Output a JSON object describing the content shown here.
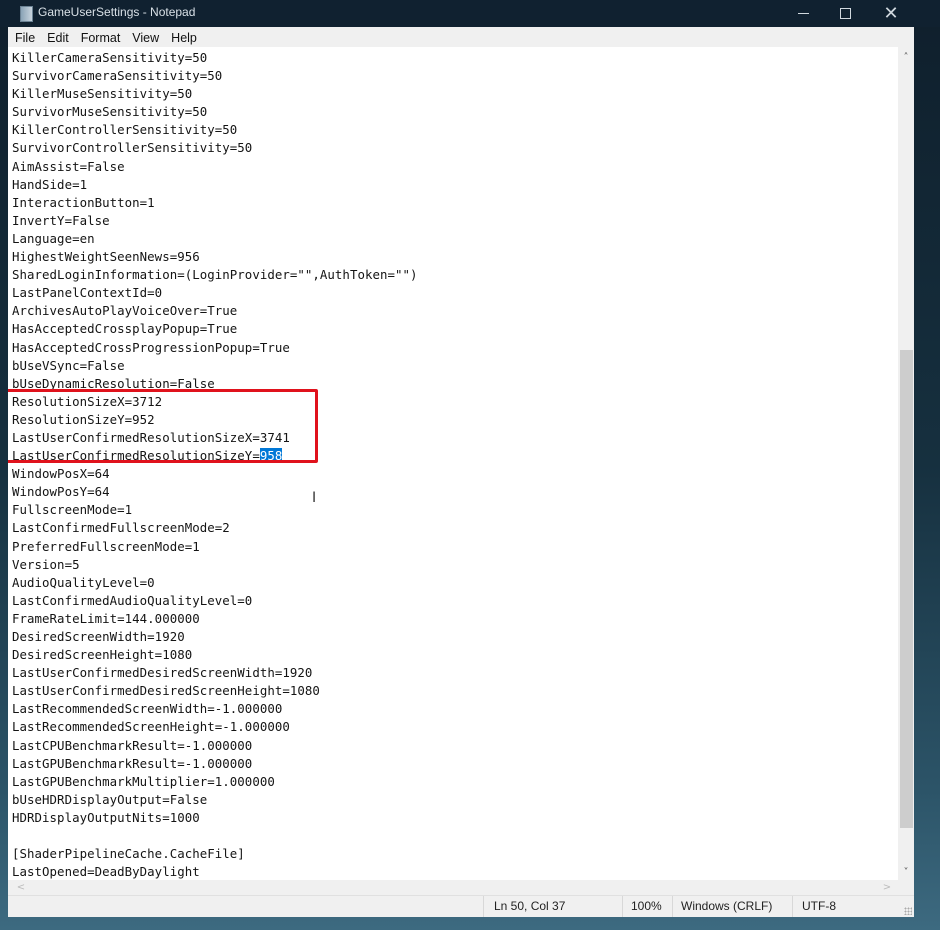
{
  "window": {
    "title": "GameUserSettings - Notepad",
    "app_icon": "notepad-icon",
    "controls": {
      "minimize": "minimize-icon",
      "maximize": "maximize-icon",
      "close": "close-icon",
      "close_glyph": "✕"
    }
  },
  "menu": {
    "items": [
      "File",
      "Edit",
      "Format",
      "View",
      "Help"
    ]
  },
  "editor": {
    "lines": [
      "KillerCameraSensitivity=50",
      "SurvivorCameraSensitivity=50",
      "KillerMuseSensitivity=50",
      "SurvivorMuseSensitivity=50",
      "KillerControllerSensitivity=50",
      "SurvivorControllerSensitivity=50",
      "AimAssist=False",
      "HandSide=1",
      "InteractionButton=1",
      "InvertY=False",
      "Language=en",
      "HighestWeightSeenNews=956",
      "SharedLoginInformation=(LoginProvider=\"\",AuthToken=\"\")",
      "LastPanelContextId=0",
      "ArchivesAutoPlayVoiceOver=True",
      "HasAcceptedCrossplayPopup=True",
      "HasAcceptedCrossProgressionPopup=True",
      "bUseVSync=False",
      "bUseDynamicResolution=False",
      "ResolutionSizeX=3712",
      "ResolutionSizeY=952",
      "LastUserConfirmedResolutionSizeX=3741",
      "LastUserConfirmedResolutionSizeY=",
      "WindowPosX=64",
      "WindowPosY=64",
      "FullscreenMode=1",
      "LastConfirmedFullscreenMode=2",
      "PreferredFullscreenMode=1",
      "Version=5",
      "AudioQualityLevel=0",
      "LastConfirmedAudioQualityLevel=0",
      "FrameRateLimit=144.000000",
      "DesiredScreenWidth=1920",
      "DesiredScreenHeight=1080",
      "LastUserConfirmedDesiredScreenWidth=1920",
      "LastUserConfirmedDesiredScreenHeight=1080",
      "LastRecommendedScreenWidth=-1.000000",
      "LastRecommendedScreenHeight=-1.000000",
      "LastCPUBenchmarkResult=-1.000000",
      "LastGPUBenchmarkResult=-1.000000",
      "LastGPUBenchmarkMultiplier=1.000000",
      "bUseHDRDisplayOutput=False",
      "HDRDisplayOutputNits=1000",
      "",
      "[ShaderPipelineCache.CacheFile]",
      "LastOpened=DeadByDaylight"
    ],
    "selected_text": "958",
    "selection_color": "#0078d7",
    "highlight_box_color": "#e0121c",
    "cursor_glyph": "I"
  },
  "scrollbars": {
    "up_glyph": "˄",
    "down_glyph": "˅",
    "left_glyph": "<",
    "right_glyph": ">"
  },
  "status": {
    "position": "Ln 50, Col 37",
    "zoom": "100%",
    "line_ending": "Windows (CRLF)",
    "encoding": "UTF-8"
  }
}
